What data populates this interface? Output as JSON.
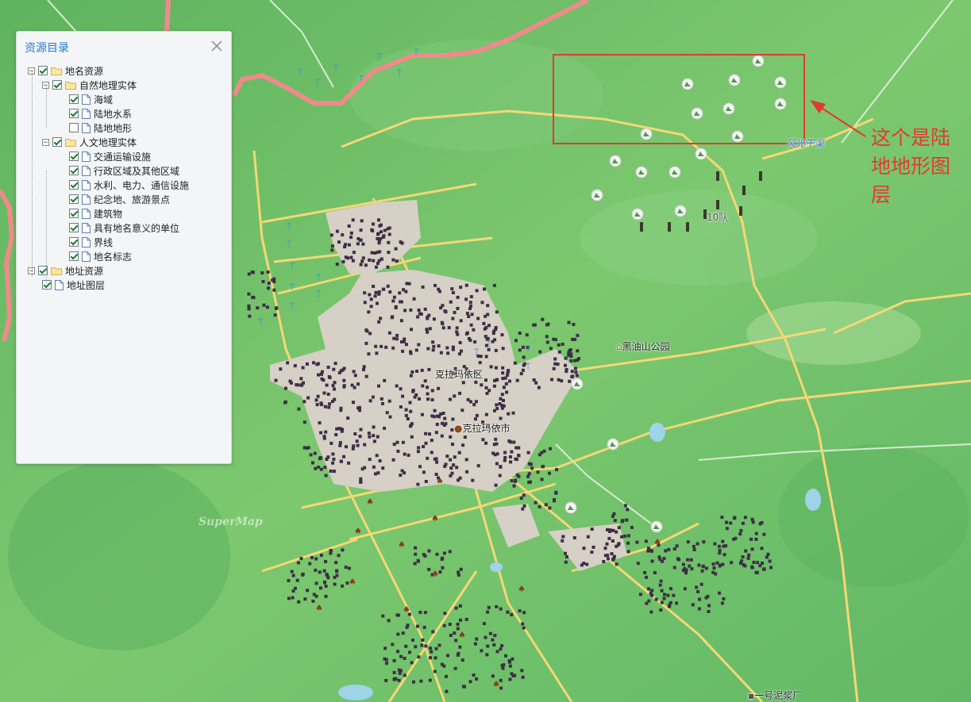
{
  "panel": {
    "title": "资源目录",
    "close_label": "×",
    "tree": [
      {
        "label": "地名资源",
        "level": 0,
        "type": "folder",
        "expanded": true,
        "checked": true
      },
      {
        "label": "自然地理实体",
        "level": 1,
        "type": "folder",
        "expanded": true,
        "checked": true
      },
      {
        "label": "海域",
        "level": 2,
        "type": "file",
        "checked": true
      },
      {
        "label": "陆地水系",
        "level": 2,
        "type": "file",
        "checked": true
      },
      {
        "label": "陆地地形",
        "level": 2,
        "type": "file",
        "checked": false
      },
      {
        "label": "人文地理实体",
        "level": 1,
        "type": "folder",
        "expanded": true,
        "checked": true
      },
      {
        "label": "交通运输设施",
        "level": 2,
        "type": "file",
        "checked": true
      },
      {
        "label": "行政区域及其他区域",
        "level": 2,
        "type": "file",
        "checked": true
      },
      {
        "label": "水利、电力、通信设施",
        "level": 2,
        "type": "file",
        "checked": true
      },
      {
        "label": "纪念地、旅游景点",
        "level": 2,
        "type": "file",
        "checked": true
      },
      {
        "label": "建筑物",
        "level": 2,
        "type": "file",
        "checked": true
      },
      {
        "label": "具有地名意义的单位",
        "level": 2,
        "type": "file",
        "checked": true
      },
      {
        "label": "界线",
        "level": 2,
        "type": "file",
        "checked": true
      },
      {
        "label": "地名标志",
        "level": 2,
        "type": "file",
        "checked": true
      },
      {
        "label": "地址资源",
        "level": 0,
        "type": "folder",
        "expanded": true,
        "checked": true
      },
      {
        "label": "地址图层",
        "level": 1,
        "type": "file",
        "checked": true
      }
    ]
  },
  "map": {
    "labels": {
      "district": "克拉玛依区",
      "park": "黑油山公园",
      "canal": "风光干渠",
      "team": "10队",
      "city": "克拉玛依市",
      "factory": "一号泥浆厂"
    },
    "watermark": "SuperMap"
  },
  "annotation": {
    "text": "这个是陆地地形图层"
  },
  "colors": {
    "panel_title": "#1f7bd6",
    "highlight_box": "#e03c2c",
    "terrain": "#6cbf6c",
    "road": "#f6d776",
    "urban": "#d6d0c6",
    "building": "#3d2f45",
    "border": "#f08a8a"
  }
}
